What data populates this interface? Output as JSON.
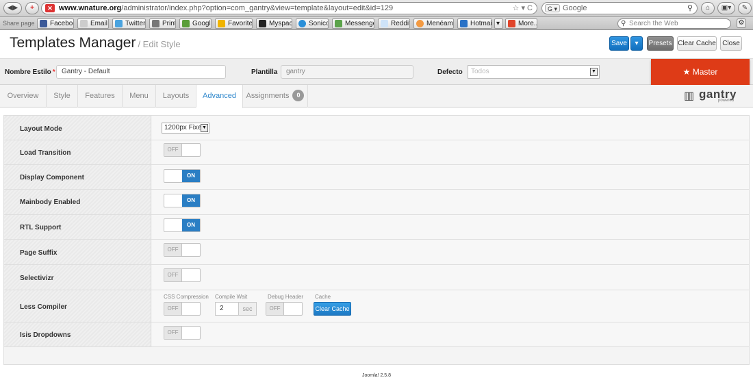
{
  "browser": {
    "url_domain": "www.wnature.org",
    "url_path": "/administrator/index.php?option=com_gantry&view=template&layout=edit&id=129",
    "search_engine": "Google",
    "search_placeholder": "Google",
    "web_search_placeholder": "Search the Web",
    "share_label": "Share page",
    "bookmarks": [
      "Facebook",
      "Email",
      "Twitter",
      "Print",
      "Google",
      "Favorites",
      "Myspace",
      "Sonico",
      "Messenger",
      "Reddit",
      "Menéame",
      "Hotmail",
      "More..."
    ]
  },
  "header": {
    "title": "Templates Manager",
    "subtitle": "/ Edit Style",
    "save_label": "Save",
    "presets_label": "Presets",
    "clear_cache_label": "Clear Cache",
    "close_label": "Close"
  },
  "style_row": {
    "name_label": "Nombre Estilo",
    "name_value": "Gantry - Default",
    "template_label": "Plantilla",
    "template_value": "gantry",
    "default_label": "Defecto",
    "default_value": "Todos",
    "master_label": "★ Master"
  },
  "tabs": [
    {
      "label": "Overview"
    },
    {
      "label": "Style"
    },
    {
      "label": "Features"
    },
    {
      "label": "Menu"
    },
    {
      "label": "Layouts"
    },
    {
      "label": "Advanced"
    },
    {
      "label": "Assignments",
      "badge": "0"
    }
  ],
  "logo": {
    "word": "gantry",
    "sub": "powered"
  },
  "settings": {
    "layout_mode": {
      "label": "Layout Mode",
      "value": "1200px Fixed"
    },
    "load_transition": {
      "label": "Load Transition",
      "state": "OFF"
    },
    "display_component": {
      "label": "Display Component",
      "state": "ON"
    },
    "mainbody_enabled": {
      "label": "Mainbody Enabled",
      "state": "ON"
    },
    "rtl_support": {
      "label": "RTL Support",
      "state": "ON"
    },
    "page_suffix": {
      "label": "Page Suffix",
      "state": "OFF"
    },
    "selectivizr": {
      "label": "Selectivizr",
      "state": "OFF"
    },
    "less_compiler": {
      "label": "Less Compiler",
      "css_compression_label": "CSS Compression",
      "css_compression_state": "OFF",
      "compile_wait_label": "Compile Wait",
      "compile_wait_value": "2",
      "compile_wait_unit": "sec",
      "debug_header_label": "Debug Header",
      "debug_header_state": "OFF",
      "cache_label": "Cache",
      "clear_cache_label": "Clear Cache"
    },
    "isis_dropdowns": {
      "label": "Isis Dropdowns",
      "state": "OFF"
    }
  },
  "footer": {
    "version": "Joomla! 2.5.8"
  },
  "colors": {
    "accent_blue": "#2a7ec4",
    "master_red": "#de3b17",
    "active_tab_text": "#2e87cc"
  }
}
